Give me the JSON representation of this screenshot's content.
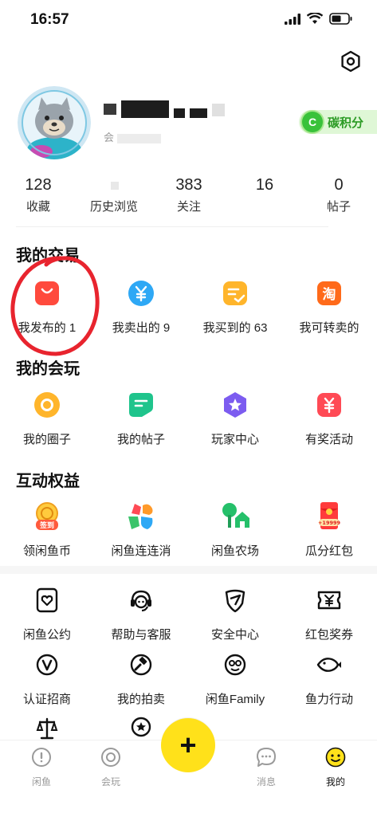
{
  "status": {
    "time": "16:57"
  },
  "profile": {
    "member_prefix": "会",
    "carbon_coin_letter": "C",
    "carbon_label": "碳积分"
  },
  "stats": [
    {
      "value": "128",
      "label": "收藏"
    },
    {
      "value": "",
      "label": "历史浏览"
    },
    {
      "value": "383",
      "label": "关注"
    },
    {
      "value": "16",
      "label": ""
    },
    {
      "value": "0",
      "label": "帖子"
    }
  ],
  "trade": {
    "title": "我的交易",
    "items": [
      {
        "label": "我发布的 1",
        "icon": "bag-icon",
        "color": "#ff4a3d"
      },
      {
        "label": "我卖出的 9",
        "icon": "yuan-icon",
        "color": "#2ea8f5"
      },
      {
        "label": "我买到的 63",
        "icon": "check-note-icon",
        "color": "#ffb52b"
      },
      {
        "label": "我可转卖的",
        "icon": "tao-icon",
        "color": "#ff6a1a"
      }
    ]
  },
  "play": {
    "title": "我的会玩",
    "items": [
      {
        "label": "我的圈子",
        "icon": "circle-icon",
        "color": "#ffb52b"
      },
      {
        "label": "我的帖子",
        "icon": "post-icon",
        "color": "#1fc48c"
      },
      {
        "label": "玩家中心",
        "icon": "star-icon",
        "color": "#7c5cf0"
      },
      {
        "label": "有奖活动",
        "icon": "prize-icon",
        "color": "#ff4a55"
      }
    ]
  },
  "benefits": {
    "title": "互动权益",
    "items": [
      {
        "label": "领闲鱼币",
        "icon": "checkin-icon",
        "badge": "签到"
      },
      {
        "label": "闲鱼连连消",
        "icon": "match-game-icon"
      },
      {
        "label": "闲鱼农场",
        "icon": "farm-icon"
      },
      {
        "label": "瓜分红包",
        "icon": "red-packet-icon",
        "badge": "+19999"
      }
    ]
  },
  "tools": {
    "items": [
      {
        "label": "闲鱼公约",
        "icon": "pact-icon"
      },
      {
        "label": "帮助与客服",
        "icon": "headset-icon"
      },
      {
        "label": "安全中心",
        "icon": "shield-icon"
      },
      {
        "label": "红包奖券",
        "icon": "coupon-icon"
      },
      {
        "label": "认证招商",
        "icon": "verified-icon"
      },
      {
        "label": "我的拍卖",
        "icon": "auction-icon"
      },
      {
        "label": "闲鱼Family",
        "icon": "family-icon"
      },
      {
        "label": "鱼力行动",
        "icon": "fish-icon"
      }
    ]
  },
  "nav": {
    "items": [
      {
        "label": "闲鱼",
        "icon": "home-icon"
      },
      {
        "label": "会玩",
        "icon": "play-icon"
      },
      {
        "label": "消息",
        "icon": "message-icon"
      },
      {
        "label": "我的",
        "icon": "mine-icon"
      }
    ],
    "fab_symbol": "+"
  }
}
